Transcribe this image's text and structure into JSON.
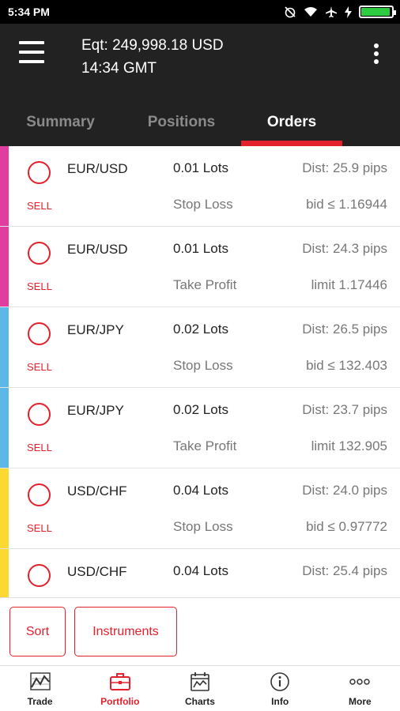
{
  "status_bar": {
    "time": "5:34 PM",
    "battery_level": 0.95
  },
  "header": {
    "equity": "Eqt: 249,998.18 USD",
    "time": "14:34 GMT"
  },
  "tabs": [
    {
      "label": "Summary",
      "active": false
    },
    {
      "label": "Positions",
      "active": false
    },
    {
      "label": "Orders",
      "active": true
    }
  ],
  "colors": {
    "accent": "#e4202c",
    "eurusd": "#e13d9e",
    "eurjpy": "#5cb8e6",
    "usdchf": "#fcd931"
  },
  "orders": [
    {
      "symbol": "EUR/USD",
      "side": "SELL",
      "lots": "0.01 Lots",
      "type": "Stop Loss",
      "dist": "Dist: 25.9 pips",
      "price": "bid ≤ 1.16944",
      "color": "#e13d9e"
    },
    {
      "symbol": "EUR/USD",
      "side": "SELL",
      "lots": "0.01 Lots",
      "type": "Take Profit",
      "dist": "Dist: 24.3 pips",
      "price": "limit 1.17446",
      "color": "#e13d9e"
    },
    {
      "symbol": "EUR/JPY",
      "side": "SELL",
      "lots": "0.02 Lots",
      "type": "Stop Loss",
      "dist": "Dist: 26.5 pips",
      "price": "bid ≤ 132.403",
      "color": "#5cb8e6"
    },
    {
      "symbol": "EUR/JPY",
      "side": "SELL",
      "lots": "0.02 Lots",
      "type": "Take Profit",
      "dist": "Dist: 23.7 pips",
      "price": "limit 132.905",
      "color": "#5cb8e6"
    },
    {
      "symbol": "USD/CHF",
      "side": "SELL",
      "lots": "0.04 Lots",
      "type": "Stop Loss",
      "dist": "Dist: 24.0 pips",
      "price": "bid ≤ 0.97772",
      "color": "#fcd931"
    },
    {
      "symbol": "USD/CHF",
      "side": "",
      "lots": "0.04 Lots",
      "type": "",
      "dist": "Dist: 25.4 pips",
      "price": "",
      "color": "#fcd931"
    }
  ],
  "actions": {
    "sort_label": "Sort",
    "instruments_label": "Instruments"
  },
  "bottom_nav": [
    {
      "label": "Trade",
      "icon": "trade-chart-icon",
      "active": false
    },
    {
      "label": "Portfolio",
      "icon": "briefcase-icon",
      "active": true
    },
    {
      "label": "Charts",
      "icon": "calendar-chart-icon",
      "active": false
    },
    {
      "label": "Info",
      "icon": "info-icon",
      "active": false
    },
    {
      "label": "More",
      "icon": "more-dots-icon",
      "active": false
    }
  ]
}
